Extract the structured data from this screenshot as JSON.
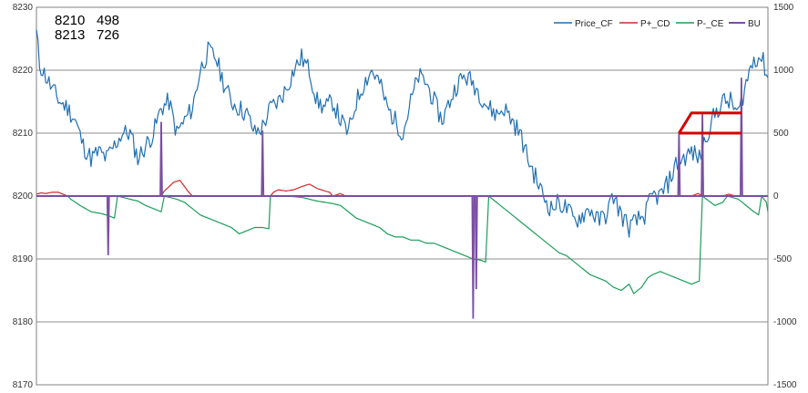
{
  "chart_data": {
    "type": "line",
    "annotations": [
      {
        "col1": "8210",
        "col2": "498"
      },
      {
        "col1": "8213",
        "col2": "726"
      }
    ],
    "y_left": {
      "min": 8170,
      "max": 8230,
      "ticks": [
        "8230",
        "8220",
        "8210",
        "8200",
        "8190",
        "8180",
        "8170"
      ]
    },
    "y_right": {
      "min": -1500,
      "max": 1500,
      "ticks": [
        "1500",
        "1000",
        "500",
        "0",
        "-500",
        "-1000",
        "-1500"
      ]
    },
    "grid": true,
    "legend_position": "top-right",
    "num_points": 470,
    "series": [
      {
        "name": "Price_CF",
        "axis": "left",
        "color": "#1f6fb2",
        "anchors": [
          [
            0,
            8226
          ],
          [
            2,
            8221
          ],
          [
            6,
            8219
          ],
          [
            10,
            8217
          ],
          [
            15,
            8215
          ],
          [
            20,
            8214
          ],
          [
            25,
            8212
          ],
          [
            30,
            8208
          ],
          [
            35,
            8206
          ],
          [
            40,
            8207
          ],
          [
            45,
            8206
          ],
          [
            50,
            8208
          ],
          [
            55,
            8210
          ],
          [
            60,
            8210
          ],
          [
            65,
            8206
          ],
          [
            70,
            8208
          ],
          [
            75,
            8210
          ],
          [
            80,
            8214
          ],
          [
            85,
            8215
          ],
          [
            90,
            8210
          ],
          [
            95,
            8212
          ],
          [
            100,
            8214
          ],
          [
            105,
            8220
          ],
          [
            110,
            8223
          ],
          [
            115,
            8222
          ],
          [
            120,
            8218
          ],
          [
            125,
            8215
          ],
          [
            130,
            8214
          ],
          [
            135,
            8213
          ],
          [
            140,
            8210
          ],
          [
            145,
            8211
          ],
          [
            150,
            8214
          ],
          [
            155,
            8215
          ],
          [
            160,
            8217
          ],
          [
            165,
            8220
          ],
          [
            170,
            8222
          ],
          [
            175,
            8220
          ],
          [
            180,
            8215
          ],
          [
            185,
            8214
          ],
          [
            190,
            8215
          ],
          [
            195,
            8212
          ],
          [
            200,
            8210
          ],
          [
            205,
            8215
          ],
          [
            210,
            8218
          ],
          [
            215,
            8220
          ],
          [
            220,
            8218
          ],
          [
            225,
            8214
          ],
          [
            230,
            8212
          ],
          [
            235,
            8210
          ],
          [
            240,
            8215
          ],
          [
            245,
            8219
          ],
          [
            250,
            8218
          ],
          [
            255,
            8215
          ],
          [
            260,
            8212
          ],
          [
            265,
            8215
          ],
          [
            270,
            8218
          ],
          [
            275,
            8219
          ],
          [
            280,
            8218
          ],
          [
            285,
            8216
          ],
          [
            290,
            8214
          ],
          [
            295,
            8213
          ],
          [
            300,
            8214
          ],
          [
            305,
            8212
          ],
          [
            310,
            8210
          ],
          [
            315,
            8206
          ],
          [
            320,
            8203
          ],
          [
            325,
            8200
          ],
          [
            330,
            8198
          ],
          [
            335,
            8199
          ],
          [
            340,
            8198
          ],
          [
            345,
            8196
          ],
          [
            350,
            8197
          ],
          [
            355,
            8198
          ],
          [
            360,
            8196
          ],
          [
            365,
            8197
          ],
          [
            370,
            8200
          ],
          [
            375,
            8197
          ],
          [
            380,
            8195
          ],
          [
            385,
            8196
          ],
          [
            390,
            8197
          ],
          [
            395,
            8200
          ],
          [
            400,
            8200
          ],
          [
            405,
            8202
          ],
          [
            410,
            8205
          ],
          [
            415,
            8206
          ],
          [
            420,
            8207
          ],
          [
            425,
            8206
          ],
          [
            430,
            8210
          ],
          [
            435,
            8213
          ],
          [
            440,
            8215
          ],
          [
            445,
            8215
          ],
          [
            450,
            8213
          ],
          [
            455,
            8218
          ],
          [
            460,
            8222
          ],
          [
            465,
            8222
          ],
          [
            469,
            8219
          ]
        ]
      },
      {
        "name": "P+_CD",
        "axis": "left",
        "color": "#d02a2a",
        "anchors": [
          [
            0,
            8200.3
          ],
          [
            3,
            8200.5
          ],
          [
            6,
            8200.4
          ],
          [
            10,
            8200.6
          ],
          [
            14,
            8200.6
          ],
          [
            18,
            8200.2
          ],
          [
            20,
            8200.0
          ],
          [
            80,
            8200.0
          ],
          [
            82,
            8200.8
          ],
          [
            85,
            8201.5
          ],
          [
            88,
            8202.2
          ],
          [
            92,
            8202.5
          ],
          [
            95,
            8201.5
          ],
          [
            97,
            8200.8
          ],
          [
            100,
            8200.0
          ],
          [
            150,
            8200.0
          ],
          [
            152,
            8200.6
          ],
          [
            155,
            8201.0
          ],
          [
            160,
            8200.8
          ],
          [
            165,
            8201.0
          ],
          [
            170,
            8201.5
          ],
          [
            175,
            8201.9
          ],
          [
            180,
            8201.2
          ],
          [
            185,
            8200.8
          ],
          [
            188,
            8200.6
          ],
          [
            190,
            8200.0
          ],
          [
            195,
            8200.4
          ],
          [
            198,
            8200.0
          ],
          [
            420,
            8200.0
          ],
          [
            424,
            8200.4
          ],
          [
            428,
            8200.0
          ],
          [
            440,
            8200.0
          ],
          [
            444,
            8200.3
          ],
          [
            448,
            8200.0
          ],
          [
            469,
            8200.0
          ]
        ]
      },
      {
        "name": "P-_CE",
        "axis": "left",
        "color": "#1c9d5a",
        "anchors": [
          [
            0,
            8200.0
          ],
          [
            20,
            8200.0
          ],
          [
            22,
            8199.5
          ],
          [
            28,
            8198.5
          ],
          [
            35,
            8197.5
          ],
          [
            42,
            8197.2
          ],
          [
            47,
            8196.8
          ],
          [
            50,
            8196.5
          ],
          [
            52,
            8200.0
          ],
          [
            60,
            8199.5
          ],
          [
            65,
            8199.2
          ],
          [
            70,
            8198.5
          ],
          [
            75,
            8198.0
          ],
          [
            80,
            8197.5
          ],
          [
            82,
            8200.0
          ],
          [
            90,
            8199.5
          ],
          [
            95,
            8199.0
          ],
          [
            100,
            8198.0
          ],
          [
            105,
            8197.0
          ],
          [
            110,
            8196.5
          ],
          [
            115,
            8196.0
          ],
          [
            120,
            8195.5
          ],
          [
            125,
            8195.0
          ],
          [
            130,
            8194.0
          ],
          [
            135,
            8194.5
          ],
          [
            140,
            8195.0
          ],
          [
            145,
            8195.0
          ],
          [
            149,
            8194.8
          ],
          [
            150,
            8200.0
          ],
          [
            160,
            8200.0
          ],
          [
            170,
            8199.8
          ],
          [
            175,
            8199.5
          ],
          [
            180,
            8199.2
          ],
          [
            185,
            8199.0
          ],
          [
            190,
            8198.8
          ],
          [
            195,
            8198.5
          ],
          [
            200,
            8197.5
          ],
          [
            205,
            8196.5
          ],
          [
            210,
            8196.0
          ],
          [
            215,
            8195.5
          ],
          [
            220,
            8195.0
          ],
          [
            225,
            8194.0
          ],
          [
            230,
            8193.5
          ],
          [
            235,
            8193.5
          ],
          [
            240,
            8193.0
          ],
          [
            245,
            8193.0
          ],
          [
            250,
            8192.5
          ],
          [
            255,
            8192.5
          ],
          [
            260,
            8192.0
          ],
          [
            265,
            8191.5
          ],
          [
            270,
            8191.0
          ],
          [
            275,
            8190.5
          ],
          [
            280,
            8190.0
          ],
          [
            285,
            8189.8
          ],
          [
            288,
            8189.5
          ],
          [
            290,
            8200.0
          ],
          [
            295,
            8199.0
          ],
          [
            300,
            8198.0
          ],
          [
            305,
            8197.0
          ],
          [
            310,
            8196.0
          ],
          [
            315,
            8195.0
          ],
          [
            320,
            8194.0
          ],
          [
            325,
            8193.0
          ],
          [
            330,
            8192.0
          ],
          [
            335,
            8191.0
          ],
          [
            340,
            8190.5
          ],
          [
            345,
            8189.5
          ],
          [
            350,
            8188.5
          ],
          [
            355,
            8187.5
          ],
          [
            360,
            8187.0
          ],
          [
            365,
            8186.5
          ],
          [
            370,
            8185.5
          ],
          [
            375,
            8185.0
          ],
          [
            380,
            8186.0
          ],
          [
            383,
            8184.5
          ],
          [
            388,
            8185.5
          ],
          [
            392,
            8187.0
          ],
          [
            395,
            8187.5
          ],
          [
            400,
            8188.0
          ],
          [
            405,
            8187.5
          ],
          [
            410,
            8187.0
          ],
          [
            415,
            8186.5
          ],
          [
            420,
            8186.0
          ],
          [
            425,
            8186.5
          ],
          [
            427,
            8200.0
          ],
          [
            435,
            8198.5
          ],
          [
            440,
            8199.0
          ],
          [
            443,
            8200.0
          ],
          [
            450,
            8199.5
          ],
          [
            455,
            8198.5
          ],
          [
            460,
            8197.5
          ],
          [
            463,
            8197.0
          ],
          [
            465,
            8200.0
          ],
          [
            468,
            8199.0
          ],
          [
            469,
            8197.5
          ]
        ]
      },
      {
        "name": "BU",
        "axis": "right",
        "color": "#7a4fa3",
        "spikes": [
          [
            46,
            -470
          ],
          [
            80,
            590
          ],
          [
            145,
            520
          ],
          [
            280,
            -975
          ],
          [
            282,
            -740
          ],
          [
            412,
            500
          ],
          [
            425,
            0
          ],
          [
            427,
            660
          ],
          [
            452,
            940
          ]
        ],
        "highlight": {
          "color": "#d40000",
          "segments": [
            [
              [
                412,
                500
              ],
              [
                420,
                660
              ],
              [
                452,
                660
              ]
            ],
            [
              [
                412,
                500
              ],
              [
                452,
                500
              ]
            ]
          ]
        }
      }
    ]
  }
}
